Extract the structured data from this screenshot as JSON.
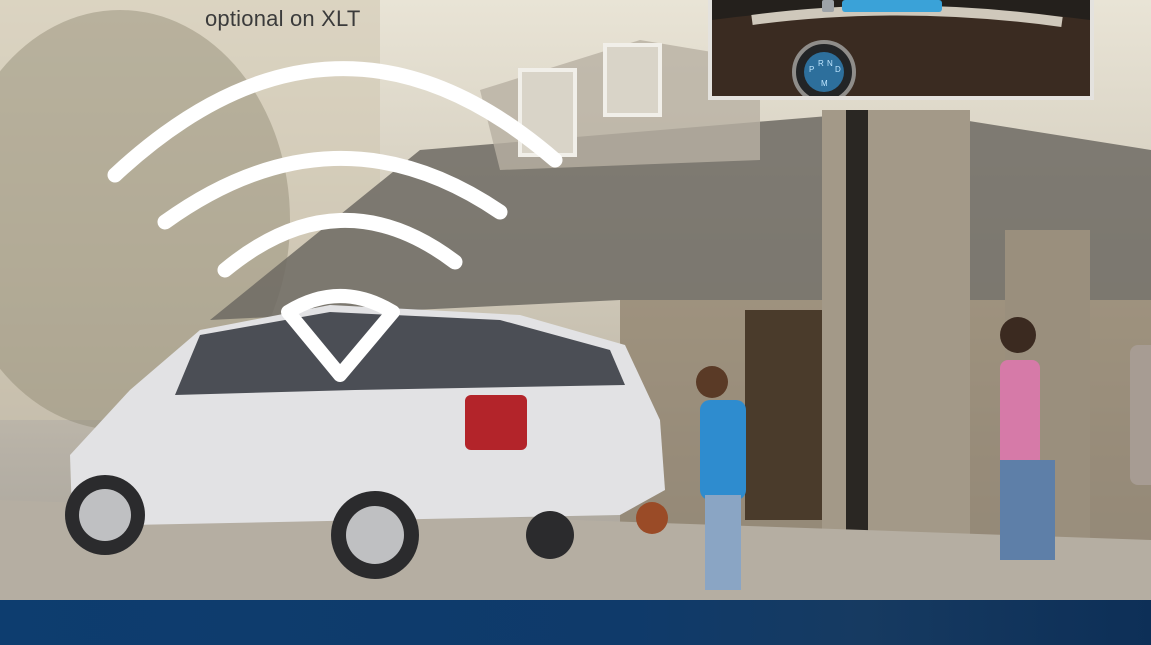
{
  "caption": {
    "text": "optional on XLT"
  },
  "inset": {
    "shifter_letters": [
      "P",
      "R",
      "N",
      "D",
      "M"
    ]
  },
  "icons": {
    "wireless": "wifi-signal-icon"
  },
  "colors": {
    "footer": "#0f3a6a",
    "signal": "#ffffff"
  }
}
